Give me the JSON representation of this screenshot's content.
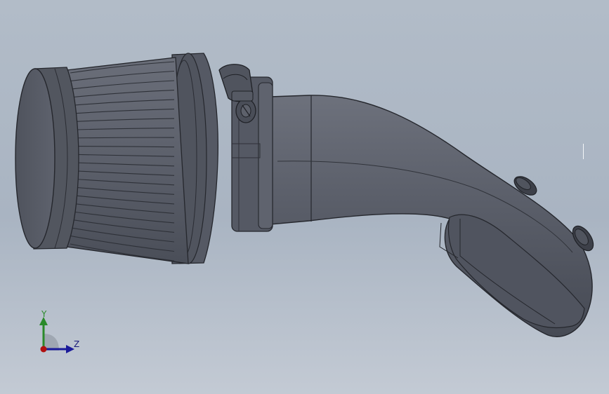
{
  "viewport": {
    "background_top": "#b2bcc8",
    "background_bottom": "#c3cad4"
  },
  "model": {
    "body_color": "#575b67",
    "edge_color": "#25272d"
  },
  "triad": {
    "y_label": "Y",
    "z_label": "Z",
    "y_color": "#2a8a2a",
    "z_color": "#1a1a9a",
    "x_color": "#b01010"
  }
}
